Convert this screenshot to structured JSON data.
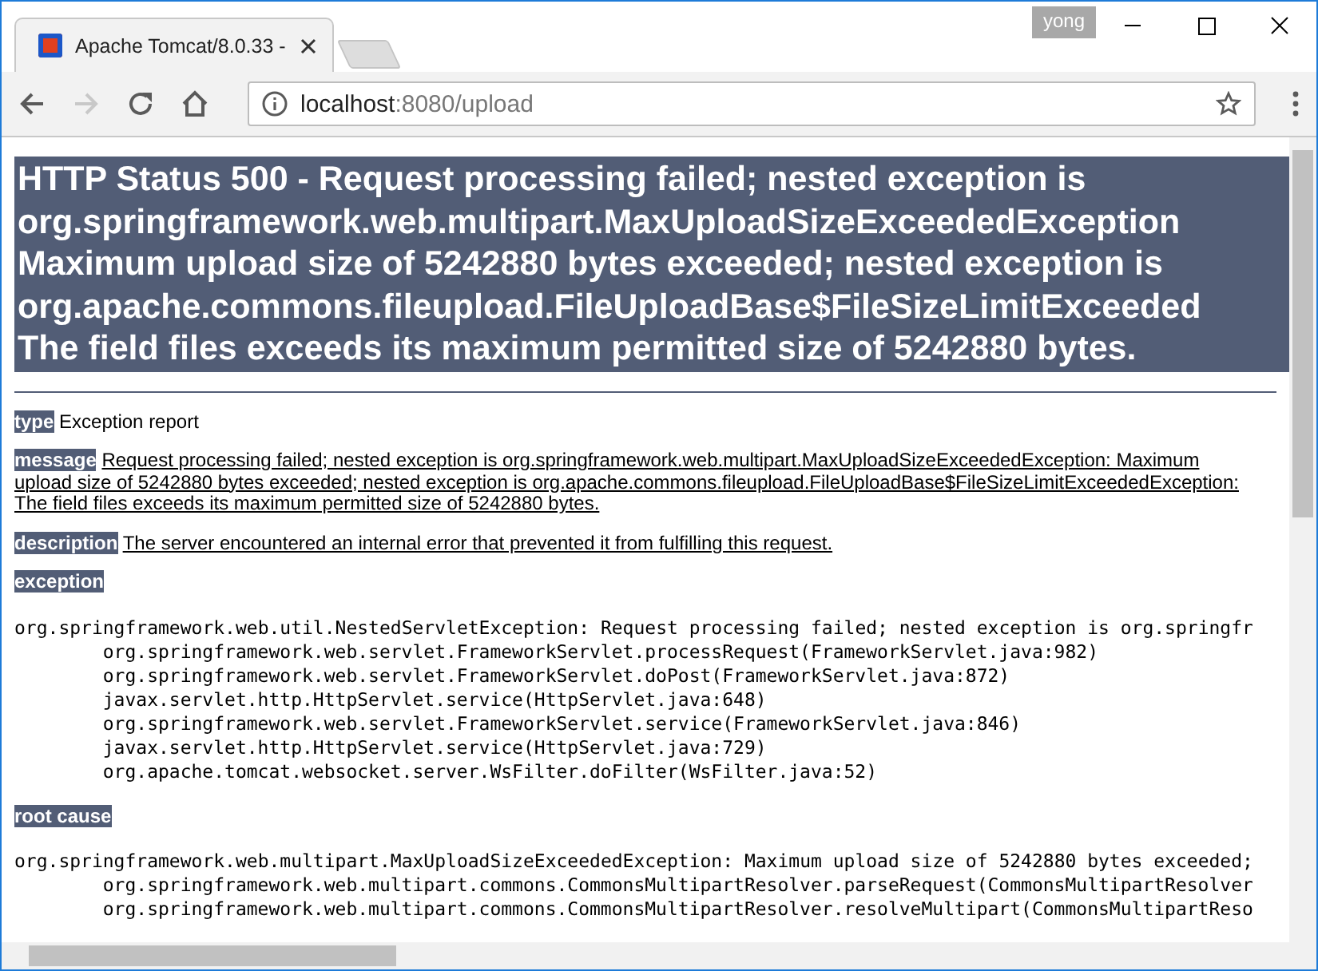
{
  "browser": {
    "profile": "yong",
    "tabs": [
      {
        "title": "Apache Tomcat/8.0.33 -",
        "selected": true
      }
    ],
    "address": {
      "host": "localhost",
      "path": ":8080/upload"
    }
  },
  "page": {
    "heading": [
      "HTTP Status 500 - Request processing failed; nested exception is",
      "org.springframework.web.multipart.MaxUploadSizeExceededException",
      "Maximum upload size of 5242880 bytes exceeded; nested exception is",
      "org.apache.commons.fileupload.FileUploadBase$FileSizeLimitExceeded",
      "The field files exceeds its maximum permitted size of 5242880 bytes."
    ],
    "sections": [
      {
        "kind": "inline",
        "label": "type",
        "text": "Exception report",
        "underlined": false
      },
      {
        "kind": "inline",
        "label": "message",
        "text": "Request processing failed; nested exception is org.springframework.web.multipart.MaxUploadSizeExceededException: Maximum upload size of 5242880 bytes exceeded; nested exception is org.apache.commons.fileupload.FileUploadBase$FileSizeLimitExceededException: The field files exceeds its maximum permitted size of 5242880 bytes.",
        "underlined": true
      },
      {
        "kind": "inline",
        "label": "description",
        "text": "The server encountered an internal error that prevented it from fulfilling this request.",
        "underlined": true
      },
      {
        "kind": "trace",
        "label": "exception",
        "lines": [
          {
            "text": "org.springframework.web.util.NestedServletException: Request processing failed; nested exception is org.springfr",
            "indented": false
          },
          {
            "text": "org.springframework.web.servlet.FrameworkServlet.processRequest(FrameworkServlet.java:982)",
            "indented": true
          },
          {
            "text": "org.springframework.web.servlet.FrameworkServlet.doPost(FrameworkServlet.java:872)",
            "indented": true
          },
          {
            "text": "javax.servlet.http.HttpServlet.service(HttpServlet.java:648)",
            "indented": true
          },
          {
            "text": "org.springframework.web.servlet.FrameworkServlet.service(FrameworkServlet.java:846)",
            "indented": true
          },
          {
            "text": "javax.servlet.http.HttpServlet.service(HttpServlet.java:729)",
            "indented": true
          },
          {
            "text": "org.apache.tomcat.websocket.server.WsFilter.doFilter(WsFilter.java:52)",
            "indented": true
          }
        ]
      },
      {
        "kind": "trace",
        "label": "root cause",
        "lines": [
          {
            "text": "org.springframework.web.multipart.MaxUploadSizeExceededException: Maximum upload size of 5242880 bytes exceeded;",
            "indented": false
          },
          {
            "text": "org.springframework.web.multipart.commons.CommonsMultipartResolver.parseRequest(CommonsMultipartResolver",
            "indented": true
          },
          {
            "text": "org.springframework.web.multipart.commons.CommonsMultipartResolver.resolveMultipart(CommonsMultipartReso",
            "indented": true
          }
        ]
      }
    ]
  }
}
